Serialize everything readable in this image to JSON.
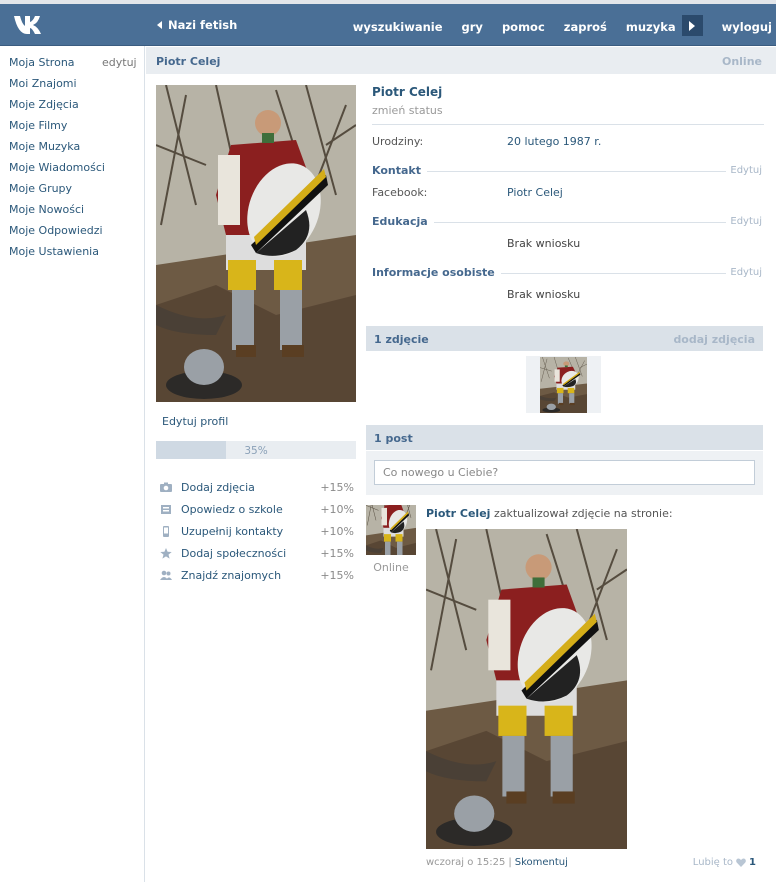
{
  "header": {
    "back_label": "Nazi fetish",
    "nav": [
      "wyszukiwanie",
      "gry",
      "pomoc",
      "zaproś",
      "muzyka"
    ],
    "logout": "wyloguj"
  },
  "sidebar": {
    "edit": "edytuj",
    "items": [
      "Moja Strona",
      "Moi Znajomi",
      "Moje Zdjęcia",
      "Moje Filmy",
      "Moje Muzyka",
      "Moje Wiadomości",
      "Moje Grupy",
      "Moje Nowości",
      "Moje Odpowiedzi",
      "Moje Ustawienia"
    ]
  },
  "page": {
    "title": "Piotr Celej",
    "status": "Online"
  },
  "profile": {
    "edit_profile": "Edytuj profil",
    "progress_label": "35%",
    "progress_value": 35,
    "tasks": [
      {
        "label": "Dodaj zdjęcia",
        "bonus": "+15%",
        "icon": "camera-icon"
      },
      {
        "label": "Opowiedz o szkole",
        "bonus": "+10%",
        "icon": "school-icon"
      },
      {
        "label": "Uzupełnij kontakty",
        "bonus": "+10%",
        "icon": "phone-icon"
      },
      {
        "label": "Dodaj społeczności",
        "bonus": "+15%",
        "icon": "star-icon"
      },
      {
        "label": "Znajdź znajomych",
        "bonus": "+15%",
        "icon": "friends-icon"
      }
    ]
  },
  "info": {
    "name": "Piotr Celej",
    "change_status": "zmień status",
    "birthday_label": "Urodziny:",
    "birthday_value": "20 lutego 1987 r.",
    "contact_title": "Kontakt",
    "facebook_label": "Facebook:",
    "facebook_value": "Piotr Celej",
    "education_title": "Edukacja",
    "education_value": "Brak wniosku",
    "personal_title": "Informacje osobiste",
    "personal_value": "Brak wniosku",
    "edit": "Edytuj"
  },
  "photos": {
    "title": "1 zdjęcie",
    "add": "dodaj zdjęcia"
  },
  "wall": {
    "title": "1 post",
    "placeholder": "Co nowego u Ciebie?",
    "post": {
      "author": "Piotr Celej",
      "action": "zaktualizował zdjęcie na stronie:",
      "online": "Online",
      "time": "wczoraj o 15:25",
      "separator": "|",
      "comment": "Skomentuj",
      "like_label": "Lubię to",
      "like_count": "1"
    }
  },
  "colors": {
    "header": "#4a6f96",
    "link": "#2b587a",
    "accent_bar": "#dae1e8"
  }
}
